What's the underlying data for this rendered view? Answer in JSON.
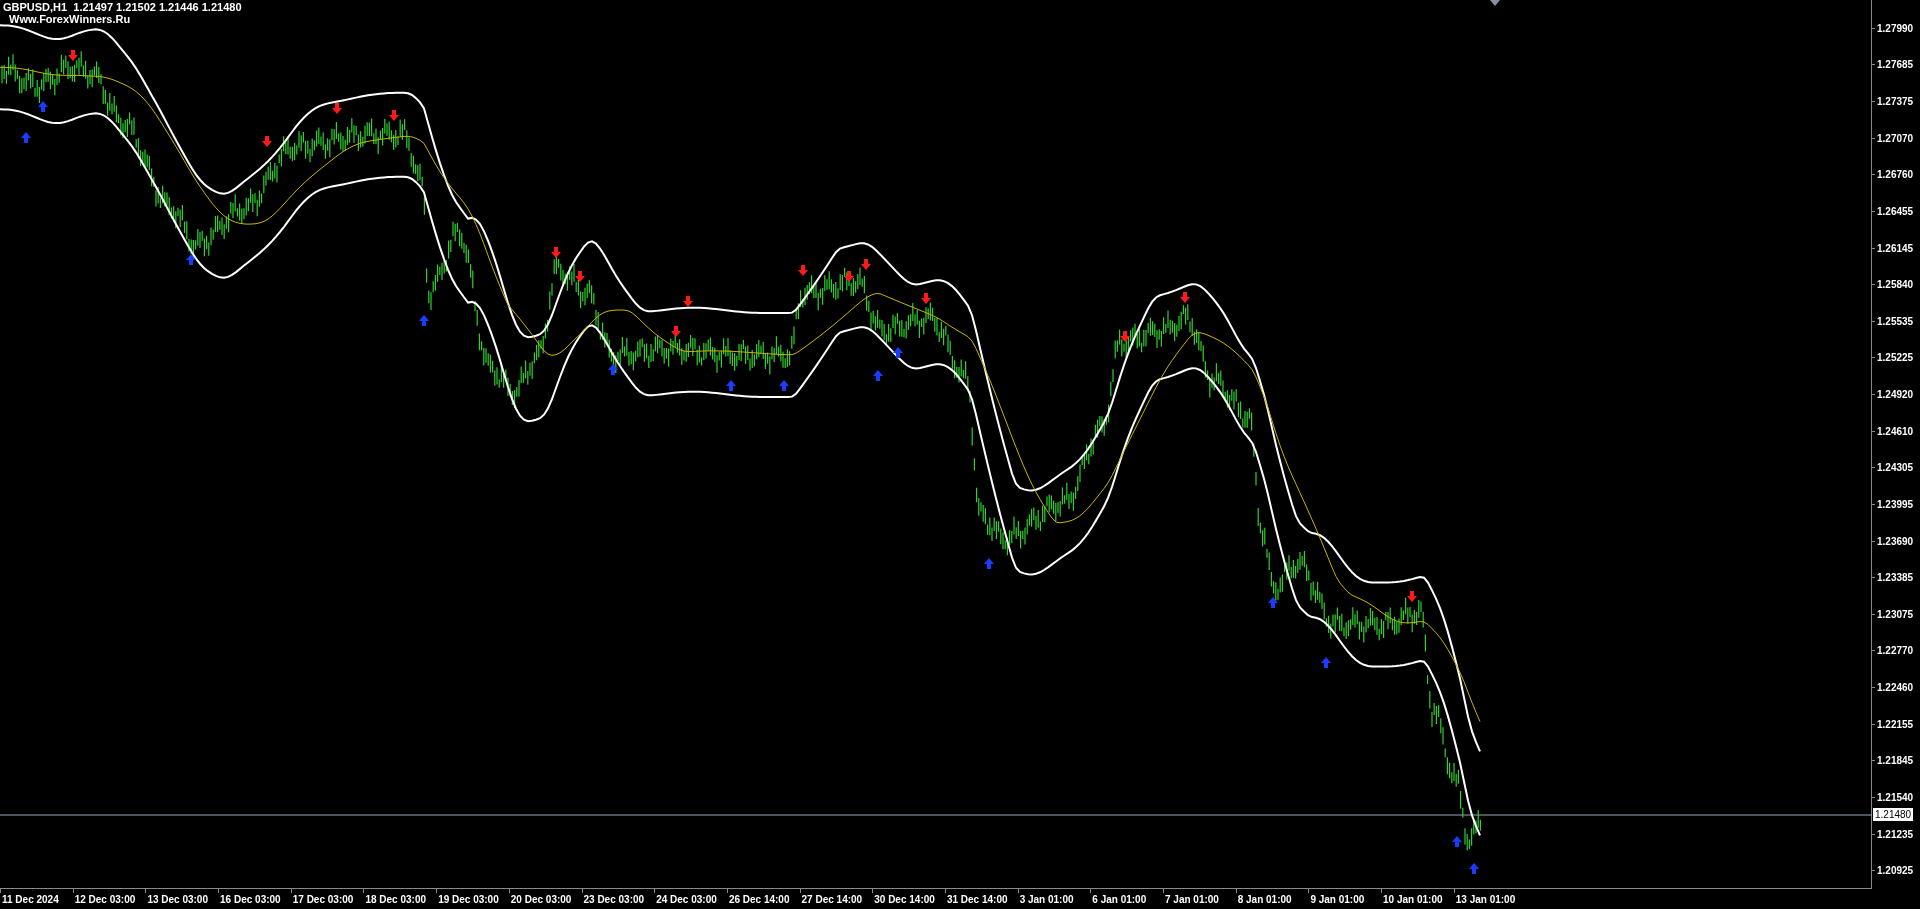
{
  "chart_header": {
    "quote_line": "GBPUSD,H1  1.21497 1.21502 1.21446 1.21480",
    "label": "Www.ForexWinners.Ru"
  },
  "price_axis": {
    "labels": [
      "1.27990",
      "1.27685",
      "1.27375",
      "1.27070",
      "1.26760",
      "1.26455",
      "1.26145",
      "1.25840",
      "1.25535",
      "1.25225",
      "1.24920",
      "1.24610",
      "1.24305",
      "1.23995",
      "1.23690",
      "1.23385",
      "1.23075",
      "1.22770",
      "1.22460",
      "1.22155",
      "1.21845",
      "1.21540",
      "1.21235",
      "1.20925"
    ],
    "current_price": "1.21480"
  },
  "time_axis": {
    "labels": [
      "11 Dec 2024",
      "12 Dec 03:00",
      "13 Dec 03:00",
      "16 Dec 03:00",
      "17 Dec 03:00",
      "18 Dec 03:00",
      "19 Dec 03:00",
      "20 Dec 03:00",
      "23 Dec 03:00",
      "24 Dec 03:00",
      "26 Dec 14:00",
      "27 Dec 14:00",
      "30 Dec 14:00",
      "31 Dec 14:00",
      "3 Jan 01:00",
      "6 Jan 01:00",
      "7 Jan 01:00",
      "8 Jan 01:00",
      "9 Jan 01:00",
      "10 Jan 01:00",
      "13 Jan 01:00"
    ]
  }
}
